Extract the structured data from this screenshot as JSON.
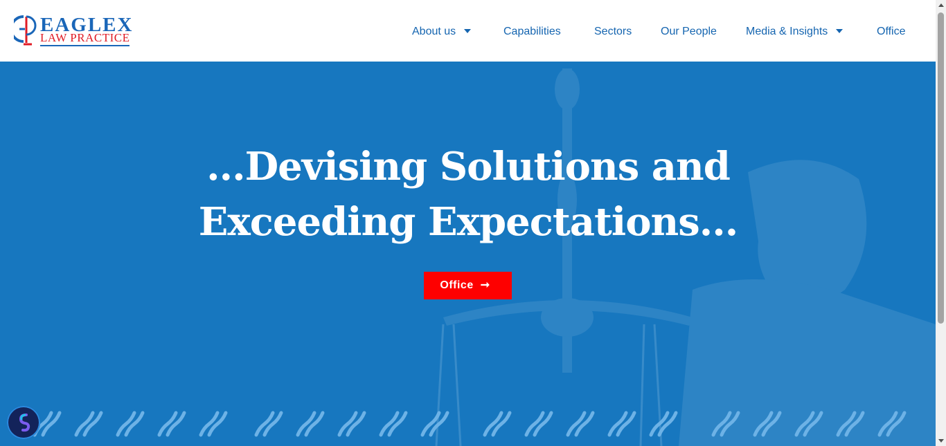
{
  "brand": {
    "name": "EAGLEX",
    "tagline": "LAW PRACTICE",
    "colors": {
      "blue": "#1a66b8",
      "red": "#e01b24"
    }
  },
  "nav": {
    "items": [
      {
        "label": "About us",
        "dropdown": true
      },
      {
        "label": "Capabilities",
        "dropdown": false
      },
      {
        "label": "Sectors",
        "dropdown": false
      },
      {
        "label": "Our People",
        "dropdown": false
      },
      {
        "label": "Media & Insights",
        "dropdown": true
      },
      {
        "label": "Office",
        "dropdown": false
      }
    ]
  },
  "hero": {
    "headline_line1": "...Devising Solutions and",
    "headline_line2": "Exceeding Expectations...",
    "button_label": "Office",
    "button_icon": "arrow-right-icon",
    "colors": {
      "background": "#1777bf",
      "button": "#fe0000"
    }
  },
  "widgets": {
    "chat_icon": "chat-bubble-icon"
  }
}
